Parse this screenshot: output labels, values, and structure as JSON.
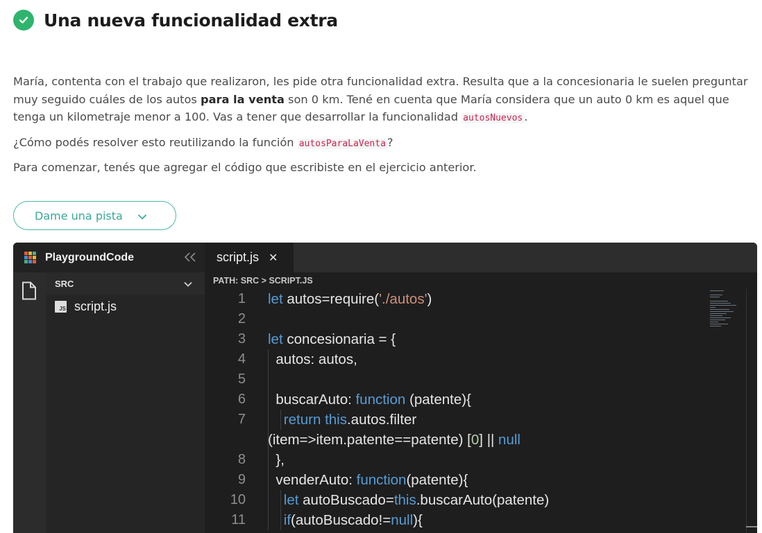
{
  "header": {
    "title": "Una nueva funcionalidad extra",
    "status_icon": "check-circle-icon",
    "status_color": "#2fb46e"
  },
  "description": {
    "p1_part1": "María, contenta con el trabajo que realizaron, les pide otra funcionalidad extra. Resulta que a la concesionaria le suelen preguntar muy seguido cuáles de los autos ",
    "p1_bold": "para la venta",
    "p1_part2": " son 0 km. Tené en cuenta que María considera que un auto 0 km es aquel que tenga un kilometraje menor a 100. Vas a tener que desarrollar la funcionalidad ",
    "p1_code": "autosNuevos",
    "p1_end": ".",
    "p2_part1": "¿Cómo podés resolver esto reutilizando la función ",
    "p2_code": "autosParaLaVenta",
    "p2_end": "?",
    "p3": "Para comenzar, tenés que agregar el código que escribiste en el ejercicio anterior."
  },
  "hint_button": {
    "label": "Dame una pista",
    "icon": "chevron-down-icon",
    "accent": "#49b8a6"
  },
  "editor": {
    "brand": "PlaygroundCode",
    "collapse_icon": "double-chevron-left-icon",
    "explorer_icon": "file-icon",
    "folder_label": "SRC",
    "file_name": "script.js",
    "file_badge": "JS",
    "tab_label": "script.js",
    "tab_close": "✕",
    "path": "PATH: SRC > SCRIPT.JS",
    "code_lines": [
      {
        "n": "1",
        "html": "<span class=\"kw\">let</span> autos=require(<span class=\"str\">'./autos'</span>)"
      },
      {
        "n": "2",
        "html": ""
      },
      {
        "n": "3",
        "html": "<span class=\"kw\">let</span> concesionaria = {"
      },
      {
        "n": "4",
        "html": "  autos: autos,"
      },
      {
        "n": "5",
        "html": ""
      },
      {
        "n": "6",
        "html": "  buscarAuto: <span class=\"kw\">function</span> (patente){"
      },
      {
        "n": "7",
        "html": "    <span class=\"kw\">return</span> <span class=\"kw\">this</span>.autos.filter"
      },
      {
        "n": "",
        "html": "(item=>item.patente==patente) [<span class=\"num\">0</span>] || <span class=\"kw\">null</span>"
      },
      {
        "n": "8",
        "html": "  },"
      },
      {
        "n": "9",
        "html": "  venderAuto: <span class=\"kw\">function</span>(patente){"
      },
      {
        "n": "10",
        "html": "    <span class=\"kw\">let</span> autoBuscado=<span class=\"kw\">this</span>.buscarAuto(patente)"
      },
      {
        "n": "11",
        "html": "    <span class=\"kw\">if</span>(autoBuscado!=<span class=\"kw\">null</span>){"
      }
    ]
  }
}
